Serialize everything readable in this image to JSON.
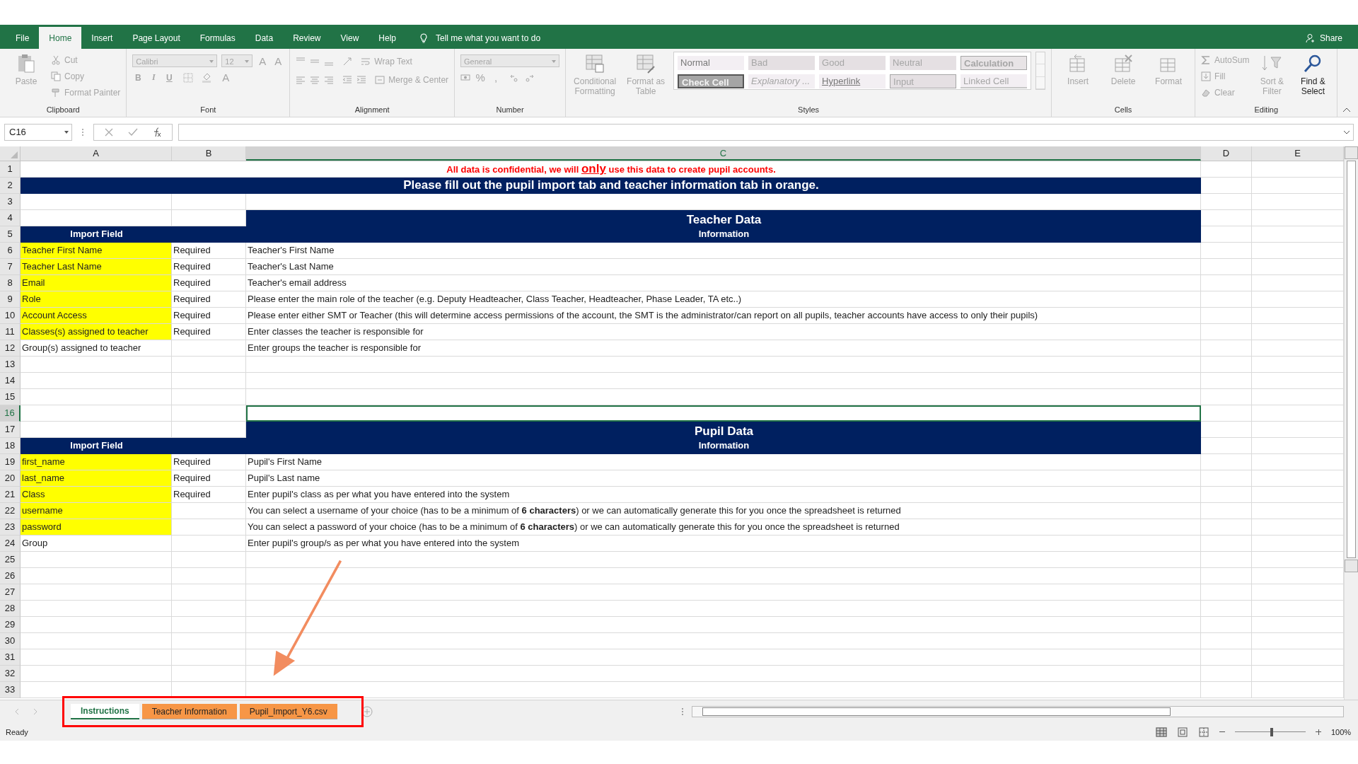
{
  "ribbon_tabs": [
    {
      "label": "File",
      "selected": false
    },
    {
      "label": "Home",
      "selected": true
    },
    {
      "label": "Insert",
      "selected": false
    },
    {
      "label": "Page Layout",
      "selected": false
    },
    {
      "label": "Formulas",
      "selected": false
    },
    {
      "label": "Data",
      "selected": false
    },
    {
      "label": "Review",
      "selected": false
    },
    {
      "label": "View",
      "selected": false
    },
    {
      "label": "Help",
      "selected": false
    }
  ],
  "tell_me": {
    "placeholder": "Tell me what you want to do"
  },
  "share": "Share",
  "ribbon": {
    "clipboard": {
      "label": "Clipboard",
      "items": [
        {
          "label": "Paste",
          "disabled": true
        },
        {
          "label": "Cut",
          "disabled": true
        },
        {
          "label": "Copy",
          "disabled": true
        },
        {
          "label": "Format Painter",
          "disabled": true
        }
      ]
    },
    "font": {
      "label": "Font",
      "font_name": "Calibri",
      "font_size": "12",
      "size_buttons": [
        "A",
        "A"
      ],
      "style_buttons": [
        "B",
        "I",
        "U"
      ],
      "color_button": "A",
      "disabled": true
    },
    "alignment": {
      "label": "Alignment",
      "items": [
        {
          "label": "Wrap Text",
          "disabled": true
        },
        {
          "label": "Merge & Center",
          "disabled": true
        }
      ]
    },
    "number": {
      "label": "Number",
      "format": "General",
      "symbols": [
        "%",
        ","
      ],
      "disabled": true
    },
    "styles": {
      "label": "Styles",
      "items": [
        {
          "label": "Conditional Formatting",
          "disabled": true
        },
        {
          "label": "Format as Table",
          "disabled": true
        }
      ],
      "cell_styles": [
        {
          "label": "Normal",
          "kind": "normal"
        },
        {
          "label": "Bad",
          "kind": "bad"
        },
        {
          "label": "Good",
          "kind": "good"
        },
        {
          "label": "Neutral",
          "kind": "neutral"
        },
        {
          "label": "Calculation",
          "kind": "calculation"
        },
        {
          "label": "Check Cell",
          "kind": "check"
        },
        {
          "label": "Explanatory ...",
          "kind": "explanatory"
        },
        {
          "label": "Hyperlink",
          "kind": "hyperlink"
        },
        {
          "label": "Input",
          "kind": "input"
        },
        {
          "label": "Linked Cell",
          "kind": "linked"
        }
      ]
    },
    "cells": {
      "label": "Cells",
      "items": [
        {
          "label": "Insert",
          "disabled": true
        },
        {
          "label": "Delete",
          "disabled": true
        },
        {
          "label": "Format",
          "disabled": true
        }
      ]
    },
    "editing": {
      "label": "Editing",
      "items": [
        {
          "label": "AutoSum",
          "disabled": true
        },
        {
          "label": "Fill",
          "disabled": true
        },
        {
          "label": "Clear",
          "disabled": true
        },
        {
          "label": "Sort & Filter",
          "disabled": true
        },
        {
          "label": "Find & Select",
          "disabled": false
        }
      ]
    }
  },
  "name_box": "C16",
  "columns": [
    {
      "label": "A",
      "selected": false
    },
    {
      "label": "B",
      "selected": false
    },
    {
      "label": "C",
      "selected": true
    },
    {
      "label": "D",
      "selected": false
    },
    {
      "label": "E",
      "selected": false
    }
  ],
  "rows": [
    {
      "num": "1",
      "kind": "notice",
      "selected": false,
      "before": "All data is confidential, we will",
      "emphasis": "only",
      "after": "use this data to create pupil accounts."
    },
    {
      "num": "2",
      "kind": "banner",
      "selected": false,
      "text": "Please fill out the pupil import tab and teacher information tab in orange."
    },
    {
      "num": "3",
      "kind": "blank",
      "selected": false
    },
    {
      "num": "4",
      "kind": "section",
      "selected": false,
      "text": "Teacher Data"
    },
    {
      "num": "5",
      "kind": "header",
      "selected": false,
      "field": "Import Field",
      "info": "Information"
    },
    {
      "num": "6",
      "kind": "field",
      "selected": false,
      "highlighted": true,
      "field": "Teacher First Name",
      "required": "Required",
      "info": "Teacher's First Name"
    },
    {
      "num": "7",
      "kind": "field",
      "selected": false,
      "highlighted": true,
      "field": "Teacher Last Name",
      "required": "Required",
      "info": "Teacher's Last Name"
    },
    {
      "num": "8",
      "kind": "field",
      "selected": false,
      "highlighted": true,
      "field": "Email",
      "required": "Required",
      "info": "Teacher's email address"
    },
    {
      "num": "9",
      "kind": "field",
      "selected": false,
      "highlighted": true,
      "field": "Role",
      "required": "Required",
      "info": "Please enter the main role of the teacher (e.g. Deputy Headteacher, Class Teacher, Headteacher, Phase Leader, TA etc..)"
    },
    {
      "num": "10",
      "kind": "field",
      "selected": false,
      "highlighted": true,
      "field": "Account Access",
      "required": "Required",
      "info": "Please enter either SMT or Teacher (this will determine access permissions of the account, the SMT is the administrator/can report on all pupils, teacher accounts have access to only their pupils)"
    },
    {
      "num": "11",
      "kind": "field",
      "selected": false,
      "highlighted": true,
      "field": "Classes(s) assigned to teacher",
      "required": "Required",
      "info": "Enter classes the teacher is responsible for"
    },
    {
      "num": "12",
      "kind": "field",
      "selected": false,
      "highlighted": false,
      "field": "Group(s) assigned to teacher",
      "info": "Enter groups the teacher is responsible for"
    },
    {
      "num": "13",
      "kind": "blank",
      "selected": false
    },
    {
      "num": "14",
      "kind": "blank",
      "selected": false
    },
    {
      "num": "15",
      "kind": "blank",
      "selected": false
    },
    {
      "num": "16",
      "kind": "blank",
      "selected": true
    },
    {
      "num": "17",
      "kind": "section",
      "selected": false,
      "text": "Pupil Data"
    },
    {
      "num": "18",
      "kind": "header",
      "selected": false,
      "field": "Import Field",
      "info": "Information"
    },
    {
      "num": "19",
      "kind": "field",
      "selected": false,
      "highlighted": true,
      "field": "first_name",
      "required": "Required",
      "info": "Pupil's First Name"
    },
    {
      "num": "20",
      "kind": "field",
      "selected": false,
      "highlighted": true,
      "field": "last_name",
      "required": "Required",
      "info": "Pupil's Last name"
    },
    {
      "num": "21",
      "kind": "field",
      "selected": false,
      "highlighted": true,
      "field": "Class",
      "required": "Required",
      "info": "Enter pupil's class as per what you have entered into the system"
    },
    {
      "num": "22",
      "kind": "field",
      "selected": false,
      "highlighted": true,
      "field": "username",
      "info": "You can select a username of your choice (has to be a minimum of **6 characters**) or we can automatically generate this for you once the spreadsheet is returned"
    },
    {
      "num": "23",
      "kind": "field",
      "selected": false,
      "highlighted": true,
      "field": "password",
      "info": "You can select a password of your choice (has to be a minimum of **6 characters**) or we can automatically generate this for you once the spreadsheet is returned"
    },
    {
      "num": "24",
      "kind": "field",
      "selected": false,
      "highlighted": false,
      "field": "Group",
      "info": "Enter pupil's group/s as per what you have entered into the system"
    },
    {
      "num": "25",
      "kind": "blank",
      "selected": false
    },
    {
      "num": "26",
      "kind": "blank",
      "selected": false
    },
    {
      "num": "27",
      "kind": "blank",
      "selected": false
    },
    {
      "num": "28",
      "kind": "blank",
      "selected": false
    },
    {
      "num": "29",
      "kind": "blank",
      "selected": false
    },
    {
      "num": "30",
      "kind": "blank",
      "selected": false
    },
    {
      "num": "31",
      "kind": "blank",
      "selected": false
    },
    {
      "num": "32",
      "kind": "blank",
      "selected": false
    },
    {
      "num": "33",
      "kind": "blank",
      "selected": false
    }
  ],
  "sheet_tabs": [
    {
      "label": "Instructions",
      "selected": true,
      "color": "#ffffff"
    },
    {
      "label": "Teacher Information",
      "selected": false,
      "color": "#f79646"
    },
    {
      "label": "Pupil_Import_Y6.csv",
      "selected": false,
      "color": "#f79646"
    }
  ],
  "status_bar": {
    "status": "Ready",
    "zoom": "100%",
    "zoom_slider": {
      "level": 0.5
    }
  }
}
